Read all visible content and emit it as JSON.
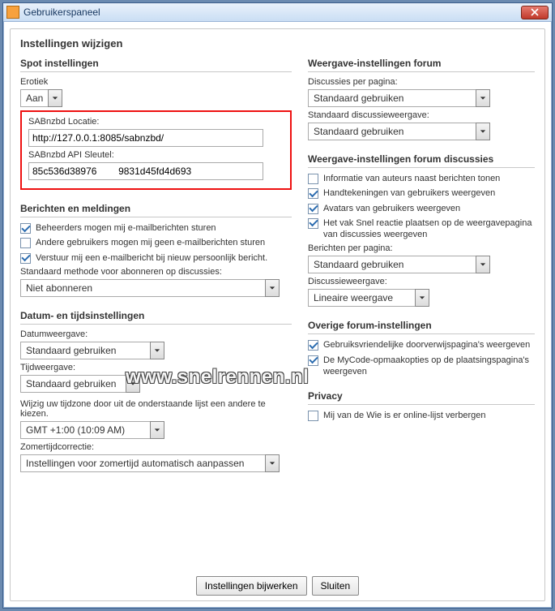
{
  "window": {
    "title": "Gebruikerspaneel"
  },
  "panel": {
    "title": "Instellingen wijzigen"
  },
  "watermark": "www.snelrennen.nl",
  "left": {
    "spot": {
      "heading": "Spot instellingen",
      "erotiek_label": "Erotiek",
      "erotiek_value": "Aan",
      "sab_loc_label": "SABnzbd Locatie:",
      "sab_loc_value": "http://127.0.0.1:8085/sabnzbd/",
      "sab_key_label": "SABnzbd API Sleutel:",
      "sab_key_value": "85c536d38976        9831d45fd4d693"
    },
    "msgs": {
      "heading": "Berichten en meldingen",
      "chk_admin": "Beheerders mogen mij e-mailberichten sturen",
      "chk_others": "Andere gebruikers mogen mij geen e-mailberichten sturen",
      "chk_pm": "Verstuur mij een e-mailbericht bij nieuw persoonlijk bericht.",
      "sub_label": "Standaard methode voor abonneren op discussies:",
      "sub_value": "Niet abonneren"
    },
    "dt": {
      "heading": "Datum- en tijdsinstellingen",
      "date_label": "Datumweergave:",
      "date_value": "Standaard gebruiken",
      "time_label": "Tijdweergave:",
      "time_value": "Standaard gebruiken",
      "tz_hint": "Wijzig uw tijdzone door uit de onderstaande lijst een andere te kiezen.",
      "tz_value": "GMT +1:00 (10:09 AM)",
      "dst_label": "Zomertijdcorrectie:",
      "dst_value": "Instellingen voor zomertijd automatisch aanpassen"
    }
  },
  "right": {
    "forum": {
      "heading": "Weergave-instellingen forum",
      "per_page_label": "Discussies per pagina:",
      "per_page_value": "Standaard gebruiken",
      "view_label": "Standaard discussieweergave:",
      "view_value": "Standaard gebruiken"
    },
    "disc": {
      "heading": "Weergave-instellingen forum discussies",
      "chk_author": "Informatie van auteurs naast berichten tonen",
      "chk_sig": "Handtekeningen van gebruikers weergeven",
      "chk_avatar": "Avatars van gebruikers weergeven",
      "chk_quick": "Het vak Snel reactie plaatsen op de weergavepagina van discussies weergeven",
      "per_page_label": "Berichten per pagina:",
      "per_page_value": "Standaard gebruiken",
      "view_label": "Discussieweergave:",
      "view_value": "Lineaire weergave"
    },
    "other": {
      "heading": "Overige forum-instellingen",
      "chk_friendly": "Gebruiksvriendelijke doorverwijspagina's weergeven",
      "chk_mycode": "De MyCode-opmaakopties op de plaatsingspagina's weergeven"
    },
    "privacy": {
      "heading": "Privacy",
      "chk_hide": "Mij van de Wie is er online-lijst verbergen"
    }
  },
  "buttons": {
    "update": "Instellingen bijwerken",
    "close": "Sluiten"
  }
}
